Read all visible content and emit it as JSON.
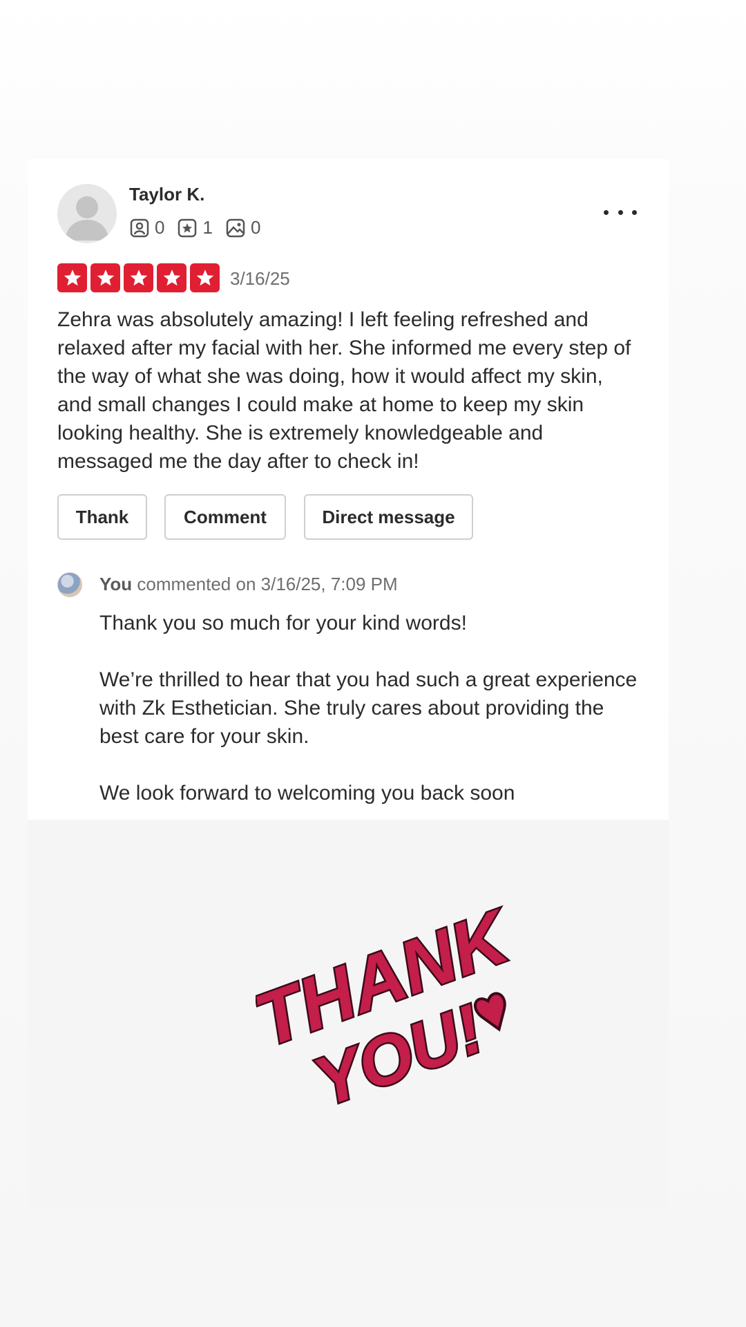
{
  "review": {
    "reviewer_name": "Taylor K.",
    "stats": {
      "friends": "0",
      "reviews": "1",
      "photos": "0"
    },
    "rating": 5,
    "date": "3/16/25",
    "text": "Zehra was absolutely amazing! I left feeling refreshed and relaxed after my facial with her. She informed me every step of the way of what she was doing, how it would affect my skin, and small changes I could make at home to keep my skin looking healthy. She is extremely knowledgeable and messaged me the day after to check in!",
    "star_color": "#e01f32"
  },
  "actions": {
    "thank": "Thank",
    "comment": "Comment",
    "direct_message": "Direct message"
  },
  "owner_comment": {
    "author": "You",
    "meta": "commented on 3/16/25, 7:09 PM",
    "paragraphs": [
      "Thank you so much for your kind words!",
      "We’re thrilled to hear that you had such a great experience with Zk Esthetician. She truly cares about providing the best care for your skin.",
      "We look forward to welcoming you back soon"
    ]
  },
  "sticker": {
    "line1": "THANK",
    "line2": "YOU!",
    "color": "#c41e4a"
  },
  "icons": [
    "friends-icon",
    "review-star-icon",
    "photo-icon",
    "more-icon",
    "star-icon"
  ]
}
